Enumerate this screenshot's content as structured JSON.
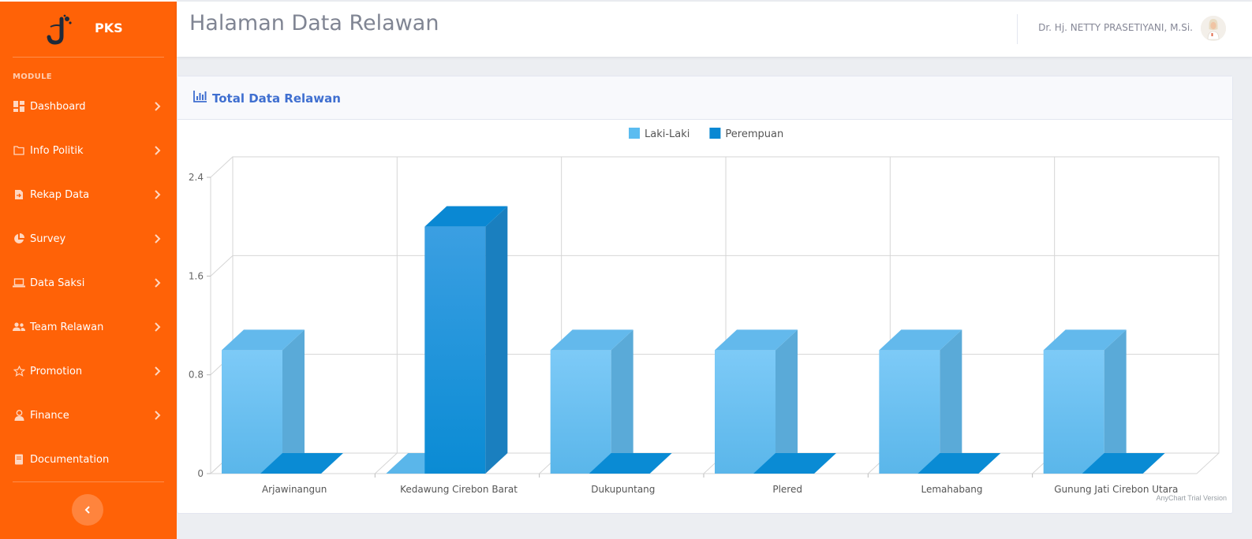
{
  "sidebar": {
    "brand": "PKS",
    "section_label": "MODULE",
    "items": [
      {
        "label": "Dashboard",
        "icon": "dashboard-grid-icon",
        "has_chevron": true
      },
      {
        "label": "Info Politik",
        "icon": "folder-icon",
        "has_chevron": true
      },
      {
        "label": "Rekap Data",
        "icon": "file-export-icon",
        "has_chevron": true
      },
      {
        "label": "Survey",
        "icon": "pie-chart-icon",
        "has_chevron": true
      },
      {
        "label": "Data Saksi",
        "icon": "laptop-icon",
        "has_chevron": true
      },
      {
        "label": "Team Relawan",
        "icon": "users-icon",
        "has_chevron": true
      },
      {
        "label": "Promotion",
        "icon": "star-icon",
        "has_chevron": true
      },
      {
        "label": "Finance",
        "icon": "user-tie-icon",
        "has_chevron": true
      },
      {
        "label": "Documentation",
        "icon": "book-icon",
        "has_chevron": false
      }
    ]
  },
  "topbar": {
    "title": "Halaman Data Relawan",
    "user_name": "Dr. Hj. NETTY PRASETIYANI, M.Si."
  },
  "card": {
    "title": "Total Data Relawan"
  },
  "colors": {
    "sidebar": "#ff6207",
    "accent_blue": "#3f6fd0",
    "laki": "#5bbcf0",
    "perempuan": "#0a88d3"
  },
  "chart_data": {
    "type": "bar",
    "categories": [
      "Arjawinangun",
      "Kedawung Cirebon Barat",
      "Dukupuntang",
      "Plered",
      "Lemahabang",
      "Gunung Jati Cirebon Utara"
    ],
    "series": [
      {
        "name": "Laki-Laki",
        "values": [
          1,
          0,
          1,
          1,
          1,
          1
        ]
      },
      {
        "name": "Perempuan",
        "values": [
          0,
          2,
          0,
          0,
          0,
          0
        ]
      }
    ],
    "ylim": [
      0,
      2.4
    ],
    "yticks": [
      "0",
      "0.8",
      "1.6",
      "2.4"
    ],
    "grid": true,
    "legend": "top-center",
    "three_d": true,
    "watermark": "AnyChart Trial Version"
  }
}
